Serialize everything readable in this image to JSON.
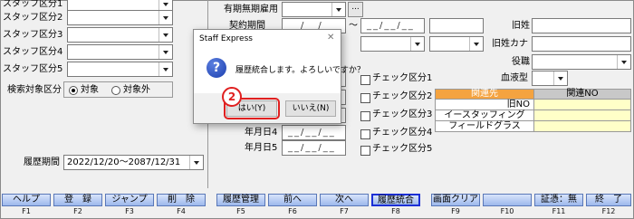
{
  "left": {
    "staff_category_labels": [
      "スタッフ区分1",
      "スタッフ区分2",
      "スタッフ区分3",
      "スタッフ区分4",
      "スタッフ区分5"
    ],
    "search_target_label": "検索対象区分",
    "radio_target": "対象",
    "radio_non_target": "対象外",
    "history_period_label": "履歴期間",
    "history_period_value": "2022/12/20〜2087/12/31"
  },
  "middle": {
    "fixed_term_label": "有期無期雇用",
    "ellipsis_button": "...",
    "contract_period_label": "契約期間",
    "date_placeholder": "__/__/__",
    "tilde": "〜",
    "date_labels": [
      "年月日4",
      "年月日5"
    ],
    "check_labels": [
      "チェック区分1",
      "チェック区分2",
      "チェック区分3",
      "チェック区分4",
      "チェック区分5"
    ]
  },
  "right": {
    "former_surname_label": "旧姓",
    "former_surname_kana_label": "旧姓カナ",
    "position_label": "役職",
    "blood_type_label": "血液型",
    "related_table": {
      "headers": [
        "関連先",
        "関連NO"
      ],
      "rows": [
        "旧NO",
        "イースタッフィング",
        "フィールドグラス"
      ]
    }
  },
  "dialog": {
    "title": "Staff Express",
    "close": "✕",
    "message": "履歴統合します。よろしいですか？",
    "yes_button": "はい(Y)",
    "no_button": "いいえ(N)",
    "callout_number": "2",
    "icon": "question-icon"
  },
  "function_keys": [
    {
      "label": "ヘルプ",
      "key": "F1"
    },
    {
      "label": "登　録",
      "key": "F2"
    },
    {
      "label": "ジャンプ",
      "key": "F3"
    },
    {
      "label": "削　除",
      "key": "F4"
    },
    {
      "label": "履歴管理",
      "key": "F5"
    },
    {
      "label": "前へ",
      "key": "F6"
    },
    {
      "label": "次へ",
      "key": "F7"
    },
    {
      "label": "履歴統合",
      "key": "F8"
    },
    {
      "label": "画面クリア",
      "key": "F9"
    },
    {
      "label": "",
      "key": "F10"
    },
    {
      "label": "証憑：無",
      "key": "F11"
    },
    {
      "label": "終　了",
      "key": "F12"
    }
  ],
  "colors": {
    "table_header_orange": "#f4a340",
    "table_header_gray": "#c8c8c8",
    "table_highlight_yellow": "#ffffc8",
    "callout_red": "#e02020",
    "fkey_blue": "#9db8ec"
  }
}
